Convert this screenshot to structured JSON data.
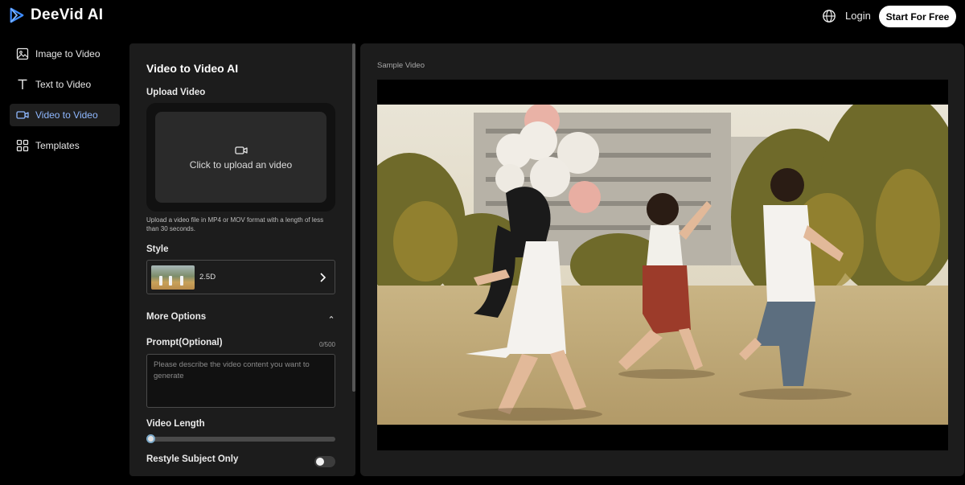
{
  "header": {
    "brand": "DeeVid AI",
    "login_label": "Login",
    "cta_label": "Start For Free",
    "icons": [
      "play-logo-icon",
      "globe-icon"
    ]
  },
  "sidebar": {
    "items": [
      {
        "label": "Image to Video",
        "icon": "image-icon",
        "active": false
      },
      {
        "label": "Text to Video",
        "icon": "text-icon",
        "active": false
      },
      {
        "label": "Video to Video",
        "icon": "video-camera-icon",
        "active": true
      },
      {
        "label": "Templates",
        "icon": "grid-icon",
        "active": false
      }
    ]
  },
  "form": {
    "title": "Video to Video AI",
    "upload_label": "Upload Video",
    "upload_prompt": "Click to upload an video",
    "upload_hint": "Upload a video file in MP4 or MOV format with a length of less than 30 seconds.",
    "style_label": "Style",
    "style_value": "2.5D",
    "more_options_label": "More Options",
    "prompt_label": "Prompt(Optional)",
    "prompt_counter": "0/500",
    "prompt_value": "",
    "prompt_placeholder": "Please describe the video content you want to generate",
    "video_length_label": "Video Length",
    "video_length_value": 0,
    "restyle_label": "Restyle Subject Only",
    "restyle_enabled": false
  },
  "preview": {
    "label": "Sample Video"
  },
  "colors": {
    "background": "#000000",
    "panel": "#1c1c1c",
    "active_nav_text": "#8fb8ff",
    "cta_background": "#ffffff"
  }
}
